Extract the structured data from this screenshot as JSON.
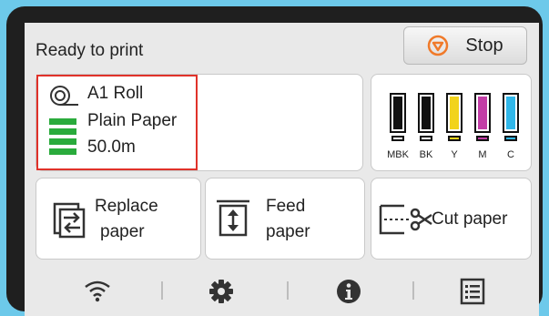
{
  "status": {
    "text": "Ready to print"
  },
  "stop_button": {
    "label": "Stop",
    "accent": "#f07a2a"
  },
  "paper": {
    "name": "A1 Roll",
    "type": "Plain Paper",
    "remaining": "50.0m",
    "level_indicator_color": "#2aab3c",
    "highlight_color": "#e0322a"
  },
  "inks": [
    {
      "label": "MBK",
      "color": "#111111"
    },
    {
      "label": "BK",
      "color": "#111111"
    },
    {
      "label": "Y",
      "color": "#f2d31b"
    },
    {
      "label": "M",
      "color": "#c23ea6"
    },
    {
      "label": "C",
      "color": "#30b7e9"
    }
  ],
  "actions": {
    "replace": {
      "line1": "Replace",
      "line2": "paper",
      "icon": "replace-paper-icon"
    },
    "feed": {
      "line1": "Feed",
      "line2": "paper",
      "icon": "feed-paper-icon"
    },
    "cut": {
      "label": "Cut paper",
      "icon": "cut-paper-icon"
    }
  },
  "bottom_icons": [
    "wifi-icon",
    "gear-icon",
    "info-icon",
    "list-icon"
  ]
}
